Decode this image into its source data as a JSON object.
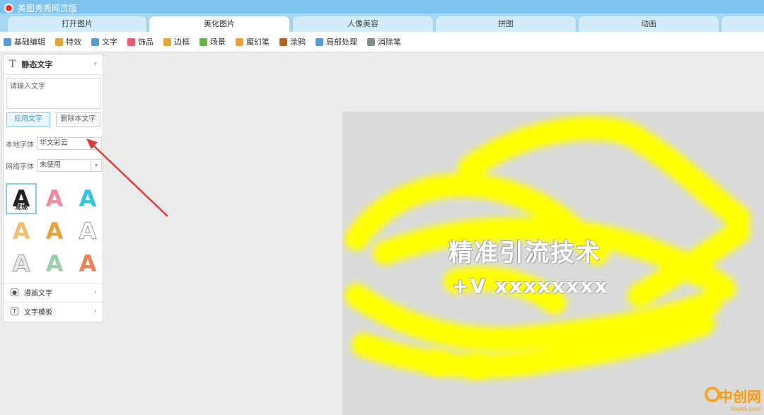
{
  "window": {
    "title": "美图秀秀网页版"
  },
  "tabs": [
    {
      "label": "打开图片",
      "active": false
    },
    {
      "label": "美化图片",
      "active": true
    },
    {
      "label": "人像美容",
      "active": false
    },
    {
      "label": "拼图",
      "active": false
    },
    {
      "label": "动画",
      "active": false
    }
  ],
  "toolbar": [
    {
      "label": "基础编辑",
      "icon": "edit-icon",
      "color": "#5b9bd5"
    },
    {
      "label": "特效",
      "icon": "magic-wand-icon",
      "color": "#e5a33a"
    },
    {
      "label": "文字",
      "icon": "text-icon",
      "color": "#5b9bd5"
    },
    {
      "label": "饰品",
      "icon": "bow-icon",
      "color": "#e85d75"
    },
    {
      "label": "边框",
      "icon": "frame-icon",
      "color": "#e5a33a"
    },
    {
      "label": "场景",
      "icon": "scene-icon",
      "color": "#6ab04c"
    },
    {
      "label": "魔幻笔",
      "icon": "magic-pen-icon",
      "color": "#e5a33a"
    },
    {
      "label": "涂鸦",
      "icon": "brush-icon",
      "color": "#b5651d"
    },
    {
      "label": "局部处理",
      "icon": "local-adjust-icon",
      "color": "#5b9bd5"
    },
    {
      "label": "消除笔",
      "icon": "eraser-icon",
      "color": "#7f8c8d"
    }
  ],
  "panel": {
    "section_title": "静态文字",
    "text_placeholder": "请输入文字",
    "apply_button": "应用文字",
    "delete_button": "删除本文字",
    "local_font_label": "本地字体",
    "local_font_value": "华文彩云",
    "web_font_label": "网络字体",
    "web_font_value": "未使用",
    "styles": [
      {
        "glyph": "A",
        "caption": "常规",
        "color": "#222"
      },
      {
        "glyph": "A",
        "caption": "",
        "color": "#f08aa0"
      },
      {
        "glyph": "A",
        "caption": "",
        "color": "#2ec6e0"
      },
      {
        "glyph": "A",
        "caption": "",
        "color": "#f0c070"
      },
      {
        "glyph": "A",
        "caption": "",
        "color": "#e8a23c"
      },
      {
        "glyph": "A",
        "caption": "",
        "color": "#ffffff"
      },
      {
        "glyph": "A",
        "caption": "",
        "color": "#e8e8e8"
      },
      {
        "glyph": "A",
        "caption": "",
        "color": "#9ad0a8"
      },
      {
        "glyph": "A",
        "caption": "",
        "color": "#f08050"
      }
    ],
    "comic_text": "漫画文字",
    "text_template": "文字模板"
  },
  "canvas": {
    "line1": "精准引流技术",
    "line2": "+V xxxxxxxx",
    "highlight_color": "#ffff00"
  },
  "watermark": {
    "cn": "中创网",
    "en": "You85.com"
  }
}
